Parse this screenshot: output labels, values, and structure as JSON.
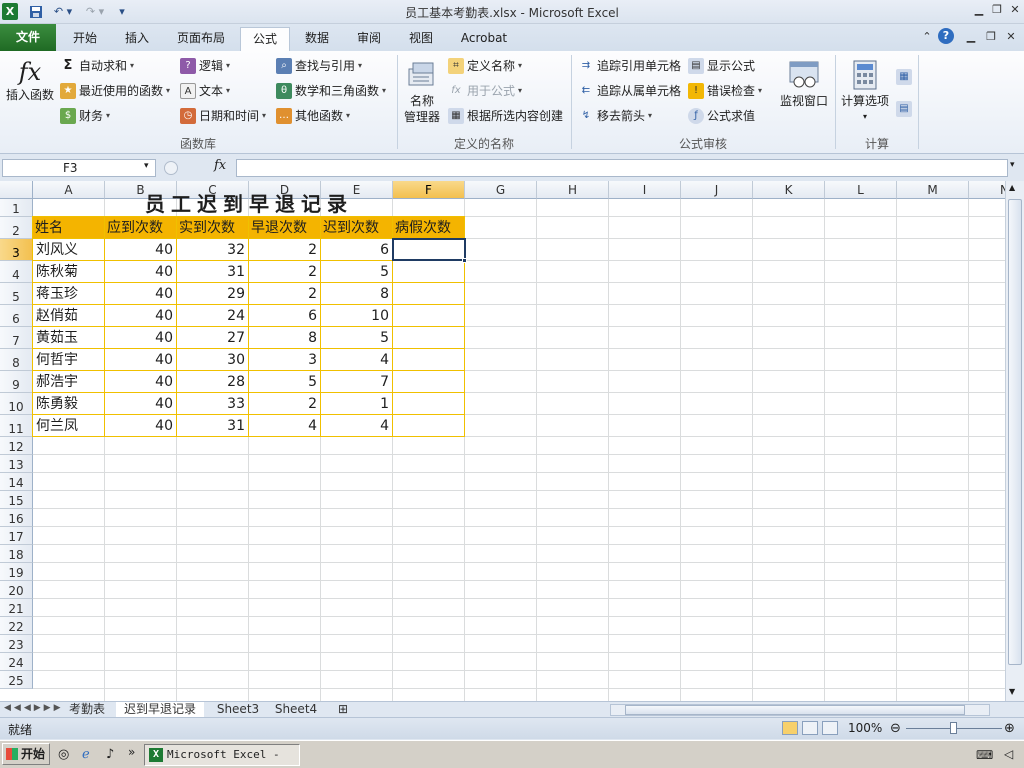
{
  "window": {
    "title": "员工基本考勤表.xlsx - Microsoft Excel"
  },
  "tabs": [
    "文件",
    "开始",
    "插入",
    "页面布局",
    "公式",
    "数据",
    "审阅",
    "视图",
    "Acrobat"
  ],
  "ribbon": {
    "library": {
      "insert_function": "插入函数",
      "autosum": "自动求和",
      "recent": "最近使用的函数",
      "financial": "财务",
      "logical": "逻辑",
      "text": "文本",
      "datetime": "日期和时间",
      "lookup": "查找与引用",
      "math": "数学和三角函数",
      "more": "其他函数",
      "group_label": "函数库"
    },
    "names": {
      "name_manager_line1": "名称",
      "name_manager_line2": "管理器",
      "define_name": "定义名称",
      "use_in_formula": "用于公式",
      "create_from_selection": "根据所选内容创建",
      "group_label": "定义的名称"
    },
    "audit": {
      "trace_precedents": "追踪引用单元格",
      "trace_dependents": "追踪从属单元格",
      "remove_arrows": "移去箭头",
      "show_formulas": "显示公式",
      "error_check": "错误检查",
      "evaluate_formula": "公式求值",
      "watch_window": "监视窗口",
      "group_label": "公式审核"
    },
    "calc": {
      "options": "计算选项",
      "group_label": "计算"
    }
  },
  "formula_bar": {
    "name_box": "F3",
    "fx": "fx",
    "value": ""
  },
  "columns": [
    "A",
    "B",
    "C",
    "D",
    "E",
    "F",
    "G",
    "H",
    "I",
    "J",
    "K",
    "L",
    "M",
    "N"
  ],
  "rows": [
    "1",
    "2",
    "3",
    "4",
    "5",
    "6",
    "7",
    "8",
    "9",
    "10",
    "11",
    "12",
    "13",
    "14",
    "15",
    "16",
    "17",
    "18",
    "19",
    "20",
    "21",
    "22",
    "23",
    "24",
    "25"
  ],
  "sheet": {
    "title": "员工迟到早退记录",
    "headers": [
      "姓名",
      "应到次数",
      "实到次数",
      "早退次数",
      "迟到次数",
      "病假次数"
    ],
    "records": [
      [
        "刘风义",
        "40",
        "32",
        "2",
        "6",
        ""
      ],
      [
        "陈秋菊",
        "40",
        "31",
        "2",
        "5",
        ""
      ],
      [
        "蒋玉珍",
        "40",
        "29",
        "2",
        "8",
        ""
      ],
      [
        "赵俏茹",
        "40",
        "24",
        "6",
        "10",
        ""
      ],
      [
        "黄茹玉",
        "40",
        "27",
        "8",
        "5",
        ""
      ],
      [
        "何哲宇",
        "40",
        "30",
        "3",
        "4",
        ""
      ],
      [
        "郝浩宇",
        "40",
        "28",
        "5",
        "7",
        ""
      ],
      [
        "陈勇毅",
        "40",
        "33",
        "2",
        "1",
        ""
      ],
      [
        "何兰凤",
        "40",
        "31",
        "4",
        "4",
        ""
      ]
    ]
  },
  "sheet_tabs": [
    "考勤表",
    "迟到早退记录",
    "Sheet3",
    "Sheet4"
  ],
  "status": {
    "ready": "就绪",
    "zoom": "100%"
  },
  "taskbar": {
    "start": "开始",
    "excel_task": "Microsoft Excel - ..."
  },
  "colors": {
    "header_fill": "#f4b400",
    "border_yellow": "#f0c000",
    "file_tab": "#2a7a2e"
  }
}
